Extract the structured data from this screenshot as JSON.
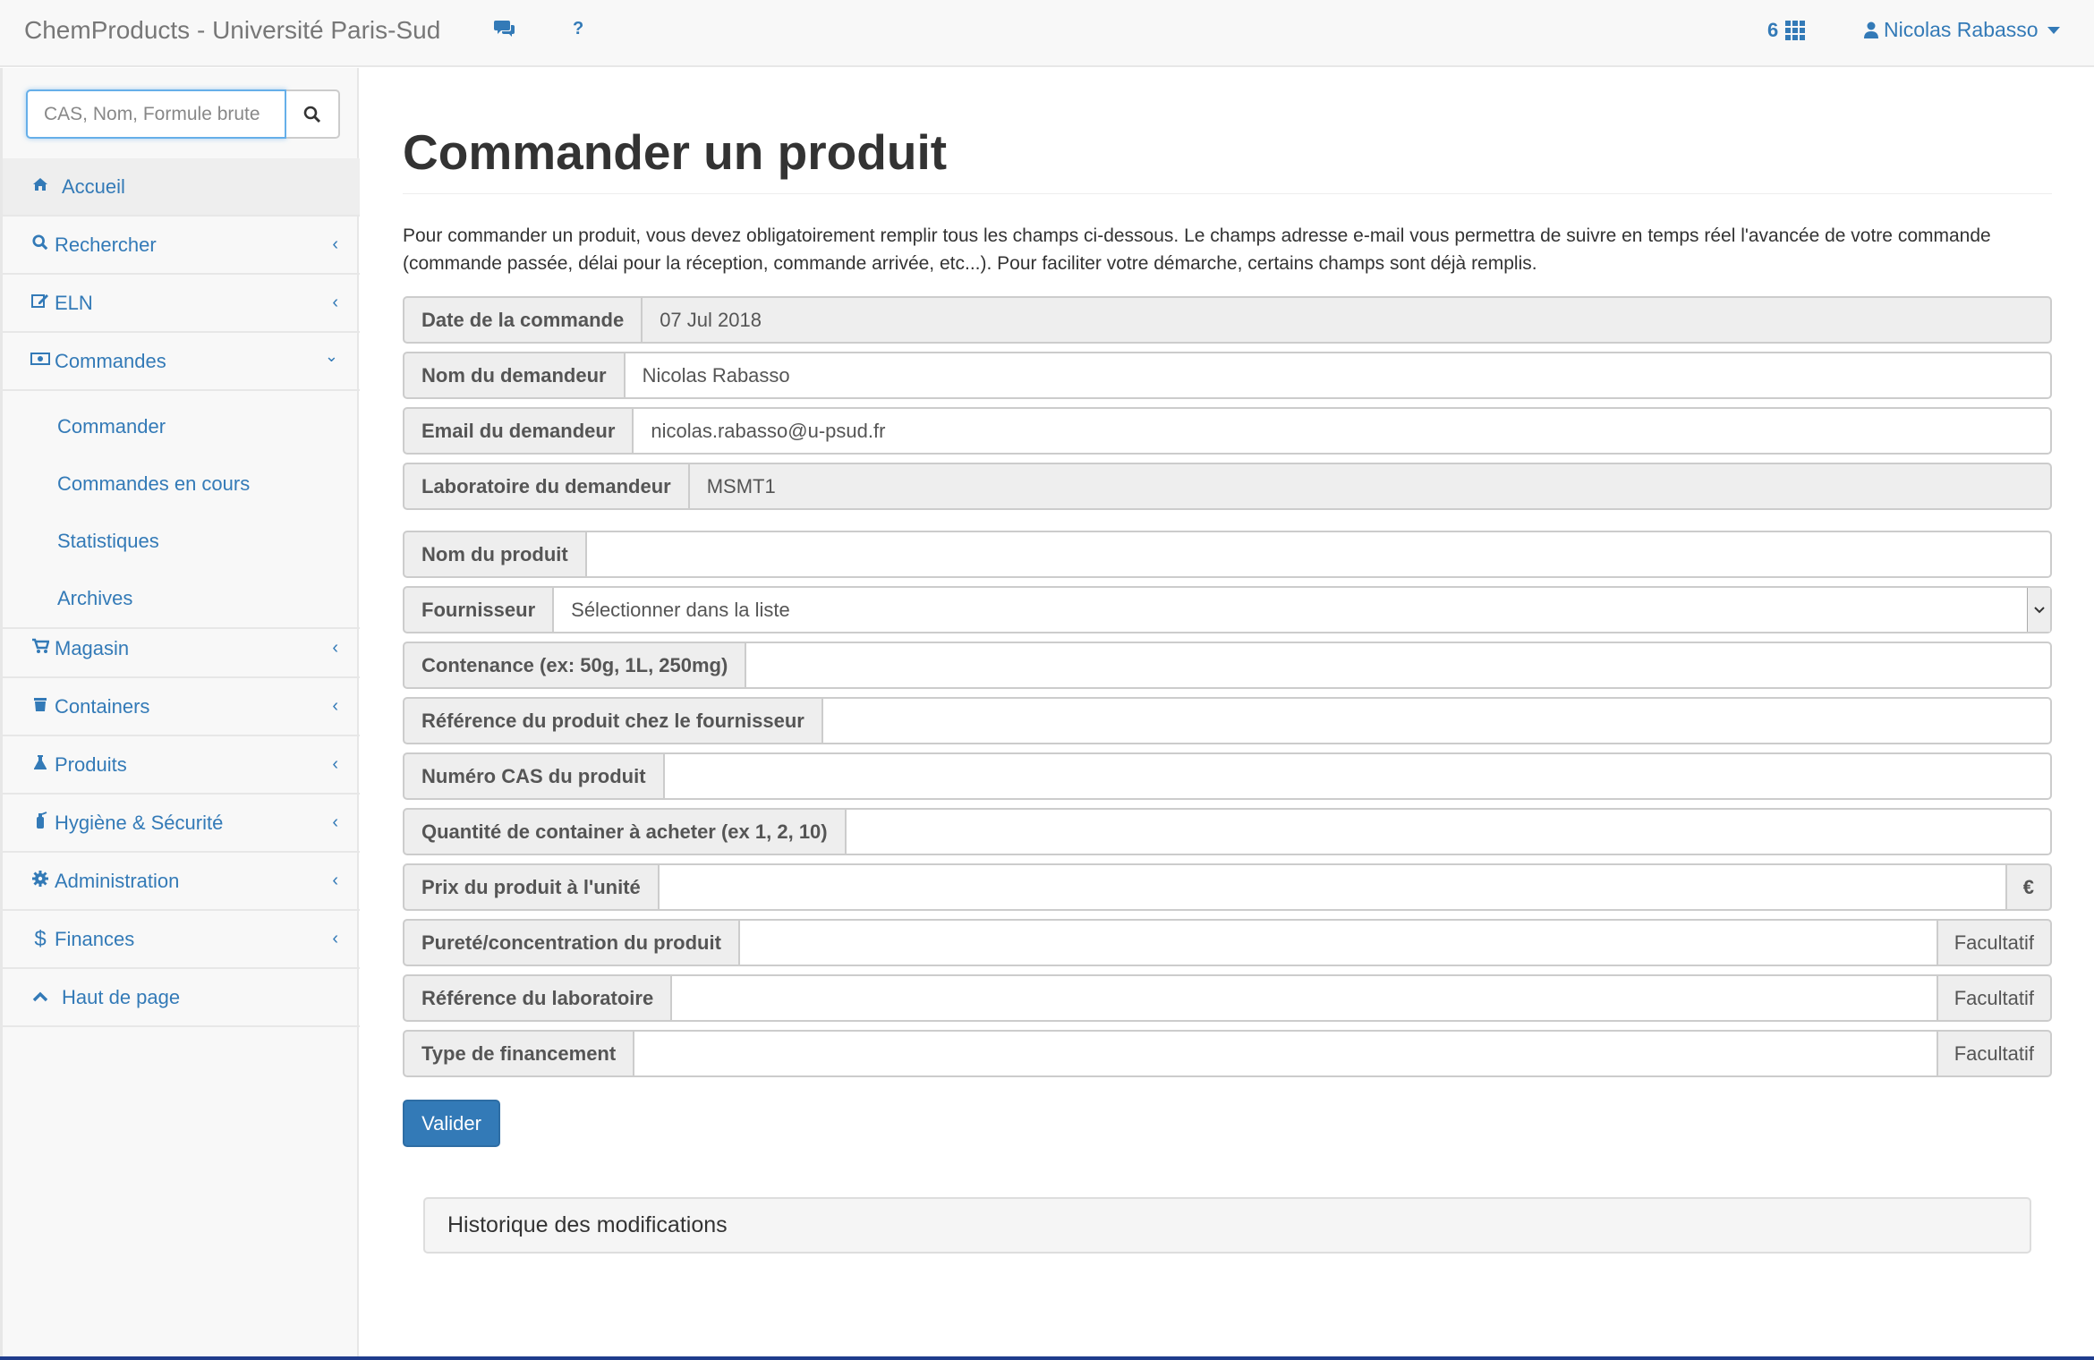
{
  "navbar": {
    "brand": "ChemProducts - Université Paris-Sud",
    "chat_icon": "comments-icon",
    "help_label": "?",
    "apps_count": "6",
    "user_name": "Nicolas Rabasso"
  },
  "sidebar": {
    "search_placeholder": "CAS, Nom, Formule brute",
    "items": [
      {
        "label": "Accueil",
        "icon": "home-icon"
      },
      {
        "label": "Rechercher",
        "icon": "search-icon"
      },
      {
        "label": "ELN",
        "icon": "edit-icon"
      },
      {
        "label": "Commandes",
        "icon": "money-icon"
      },
      {
        "label": "Magasin",
        "icon": "cart-icon"
      },
      {
        "label": "Containers",
        "icon": "trash-icon"
      },
      {
        "label": "Produits",
        "icon": "flask-icon"
      },
      {
        "label": "Hygiène & Sécurité",
        "icon": "fire-extinguisher-icon"
      },
      {
        "label": "Administration",
        "icon": "cog-icon"
      },
      {
        "label": "Finances",
        "icon": "dollar-icon"
      },
      {
        "label": "Haut de page",
        "icon": "chevron-up-icon"
      }
    ],
    "sub_items": [
      "Commander",
      "Commandes en cours",
      "Statistiques",
      "Archives"
    ]
  },
  "main": {
    "title": "Commander un produit",
    "intro": "Pour commander un produit, vous devez obligatoirement remplir tous les champs ci-dessous. Le champs adresse e-mail vous permettra de suivre en temps réel l'avancée de votre commande (commande passée, délai pour la réception, commande arrivée, etc...). Pour faciliter votre démarche, certains champs sont déjà remplis.",
    "fields": {
      "date": {
        "label": "Date de la commande",
        "value": "07 Jul 2018"
      },
      "nom": {
        "label": "Nom du demandeur",
        "value": "Nicolas Rabasso"
      },
      "email": {
        "label": "Email du demandeur",
        "value": "nicolas.rabasso@u-psud.fr"
      },
      "labo": {
        "label": "Laboratoire du demandeur",
        "value": "MSMT1"
      },
      "produit": {
        "label": "Nom du produit",
        "value": ""
      },
      "fournisseur": {
        "label": "Fournisseur",
        "value": "Sélectionner dans la liste"
      },
      "contenance": {
        "label": "Contenance (ex: 50g, 1L, 250mg)",
        "value": ""
      },
      "reference": {
        "label": "Référence du produit chez le fournisseur",
        "value": ""
      },
      "cas": {
        "label": "Numéro CAS du produit",
        "value": ""
      },
      "quantite": {
        "label": "Quantité de container à acheter (ex 1, 2, 10)",
        "value": ""
      },
      "prix": {
        "label": "Prix du produit à l'unité",
        "value": "",
        "suffix": "€"
      },
      "purete": {
        "label": "Pureté/concentration du produit",
        "value": "",
        "suffix": "Facultatif"
      },
      "ref_labo": {
        "label": "Référence du laboratoire",
        "value": "",
        "suffix": "Facultatif"
      },
      "financement": {
        "label": "Type de financement",
        "value": "",
        "suffix": "Facultatif"
      }
    },
    "submit_label": "Valider",
    "history_title": "Historique des modifications"
  }
}
